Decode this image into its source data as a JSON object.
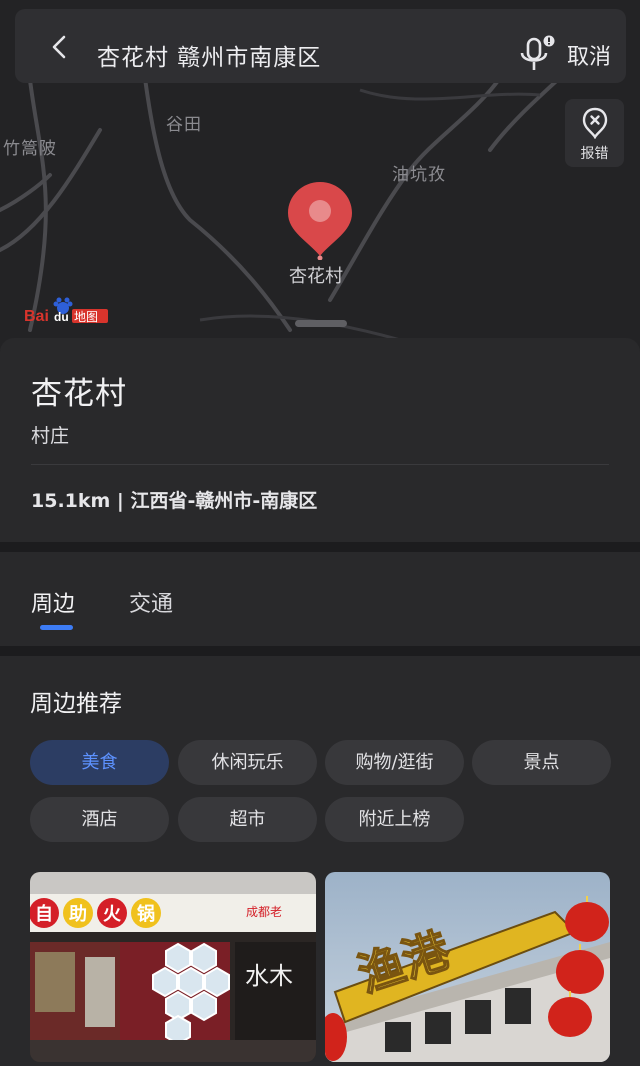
{
  "search": {
    "query": "杏花村 赣州市南康区",
    "cancel_label": "取消"
  },
  "map": {
    "place_labels": [
      "谷田",
      "竹篙陂",
      "油坑孜"
    ],
    "pin_label": "杏花村",
    "report_label": "报错",
    "logo_text": "Baidu地图"
  },
  "poi": {
    "name": "杏花村",
    "type": "村庄",
    "distance": "15.1km",
    "separator": " | ",
    "address": "江西省-赣州市-南康区"
  },
  "tabs": [
    {
      "label": "周边",
      "active": true
    },
    {
      "label": "交通",
      "active": false
    }
  ],
  "recommend": {
    "title": "周边推荐",
    "categories": [
      "美食",
      "休闲玩乐",
      "购物/逛街",
      "景点",
      "酒店",
      "超市",
      "附近上榜"
    ],
    "active_category": "美食",
    "photos": [
      {
        "sign_text": "自助火锅",
        "sub_text": "成都老",
        "wall_text": "水木"
      },
      {
        "sign_text": "渔港"
      }
    ]
  },
  "colors": {
    "accent": "#3d7cf5",
    "pin": "#d9484a",
    "chip_active_bg": "#2c3d63"
  }
}
